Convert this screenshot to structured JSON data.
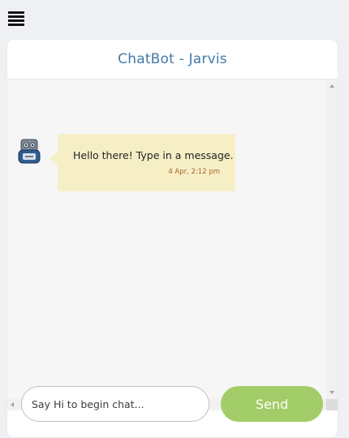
{
  "header": {
    "title": "ChatBot - Jarvis"
  },
  "messages": [
    {
      "sender": "bot",
      "text": "Hello there! Type in a message.",
      "time": "4 Apr, 2:12 pm"
    }
  ],
  "composer": {
    "placeholder": "Say Hi to begin chat...",
    "value": "",
    "send_label": "Send"
  },
  "colors": {
    "title": "#4479a8",
    "bubble": "#f6efc6",
    "time": "#a9642a",
    "send": "#a2cc67"
  },
  "icons": {
    "menu": "hamburger-menu-icon",
    "avatar": "robot-icon"
  }
}
